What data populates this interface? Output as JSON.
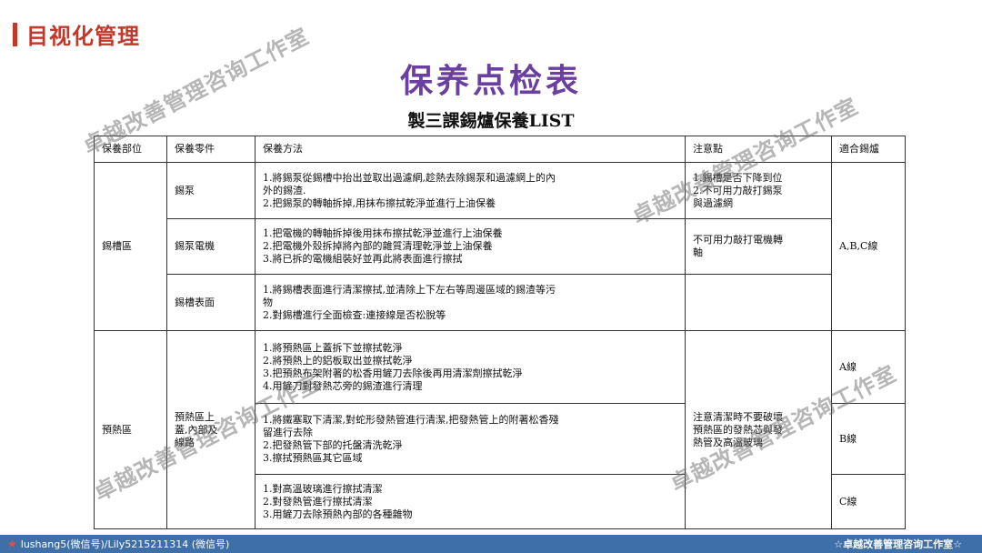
{
  "header": {
    "title": "目视化管理"
  },
  "main_title": "保养点检表",
  "sub_title": "製三課錫爐保養LIST",
  "table": {
    "headers": [
      "保養部位",
      "保養零件",
      "保養方法",
      "注意點",
      "適合錫爐"
    ],
    "rows": [
      {
        "area": "錫槽區",
        "part": "錫泵",
        "method": [
          "1.將錫泵從錫槽中抬出並取出過濾網,趁熱去除錫泵和過濾網上的內",
          "外的錫渣.",
          "2.把錫泵的轉軸拆掉,用抹布擦拭乾淨並進行上油保養"
        ],
        "notes": [
          "1.錫槽是否下降到位",
          "2.不可用力敲打錫泵",
          "與過濾網"
        ],
        "line": "A,B,C線"
      },
      {
        "part": "錫泵電機",
        "method": [
          "1.把電機的轉軸拆掉後用抹布擦拭乾淨並進行上油保養",
          "2.把電機外殼拆掉將內部的雜質清理乾淨並上油保養",
          "3.將已拆的電機組裝好並再此將表面進行擦拭"
        ],
        "notes": [
          "不可用力敲打電機轉",
          "軸"
        ]
      },
      {
        "part": "錫槽表面",
        "method": [
          "1.將錫槽表面進行清潔擦拭,並清除上下左右等周邊區域的錫渣等污",
          "物",
          "2.對錫槽進行全面檢查:連接線是否松脫等"
        ],
        "notes": []
      },
      {
        "area": "預熱區",
        "part": [
          "預熱區上",
          "蓋,內部及",
          "線路"
        ],
        "method": [
          "1.將預熱區上蓋拆下並擦拭乾淨",
          "2.將預熱上的鋁板取出並擦拭乾淨",
          "3.把預熱布架附著的松香用鏟刀去除後再用清潔劑擦拭乾淨",
          "4.用鏟刀對發熱芯旁的錫渣進行清理"
        ],
        "notes": [
          "注意清潔時不要破壞",
          "預熱區的發熱芯與發",
          "熱管及高溫玻璃"
        ],
        "line": "A線"
      },
      {
        "method": [
          "1.將鐵塞取下清潔,對蛇形發熱管進行清潔,把發熱管上的附著松香殘",
          "留進行去除",
          "2.把發熱管下部的托盤清洗乾淨",
          "3.擦拭預熱區其它區域"
        ],
        "line": "B線"
      },
      {
        "method": [
          "1.對高溫玻璃進行擦拭清潔",
          "2.對發熱管進行擦拭清潔",
          "3.用鏟刀去除預熱內部的各種雜物"
        ],
        "line": "C線"
      }
    ]
  },
  "watermarks": [
    "卓越改善管理咨询工作室",
    "卓越改善管理咨询工作室",
    "卓越改善管理咨询工作室",
    "卓越改善管理咨询工作室"
  ],
  "footer": {
    "left": "lushang5(微信号)/Lily5215211314 (微信号)",
    "right": "☆卓越改善管理咨询工作室☆"
  }
}
